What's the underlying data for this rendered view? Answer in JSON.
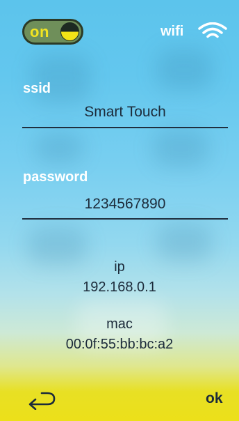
{
  "header": {
    "toggle_label": "on",
    "wifi_label": "wifi"
  },
  "ssid": {
    "label": "ssid",
    "value": "Smart Touch"
  },
  "password": {
    "label": "password",
    "value": "1234567890"
  },
  "ip": {
    "label": "ip",
    "value": "192.168.0.1"
  },
  "mac": {
    "label": "mac",
    "value": "00:0f:55:bb:bc:a2"
  },
  "footer": {
    "ok_label": "ok",
    "back_icon": "back-arrow-icon"
  },
  "colors": {
    "sky": "#63c7ee",
    "field_yellow": "#ece019",
    "toggle_bg": "#6f8f5a",
    "text_dark": "#1c2b3a",
    "text_light": "#ffffff"
  }
}
